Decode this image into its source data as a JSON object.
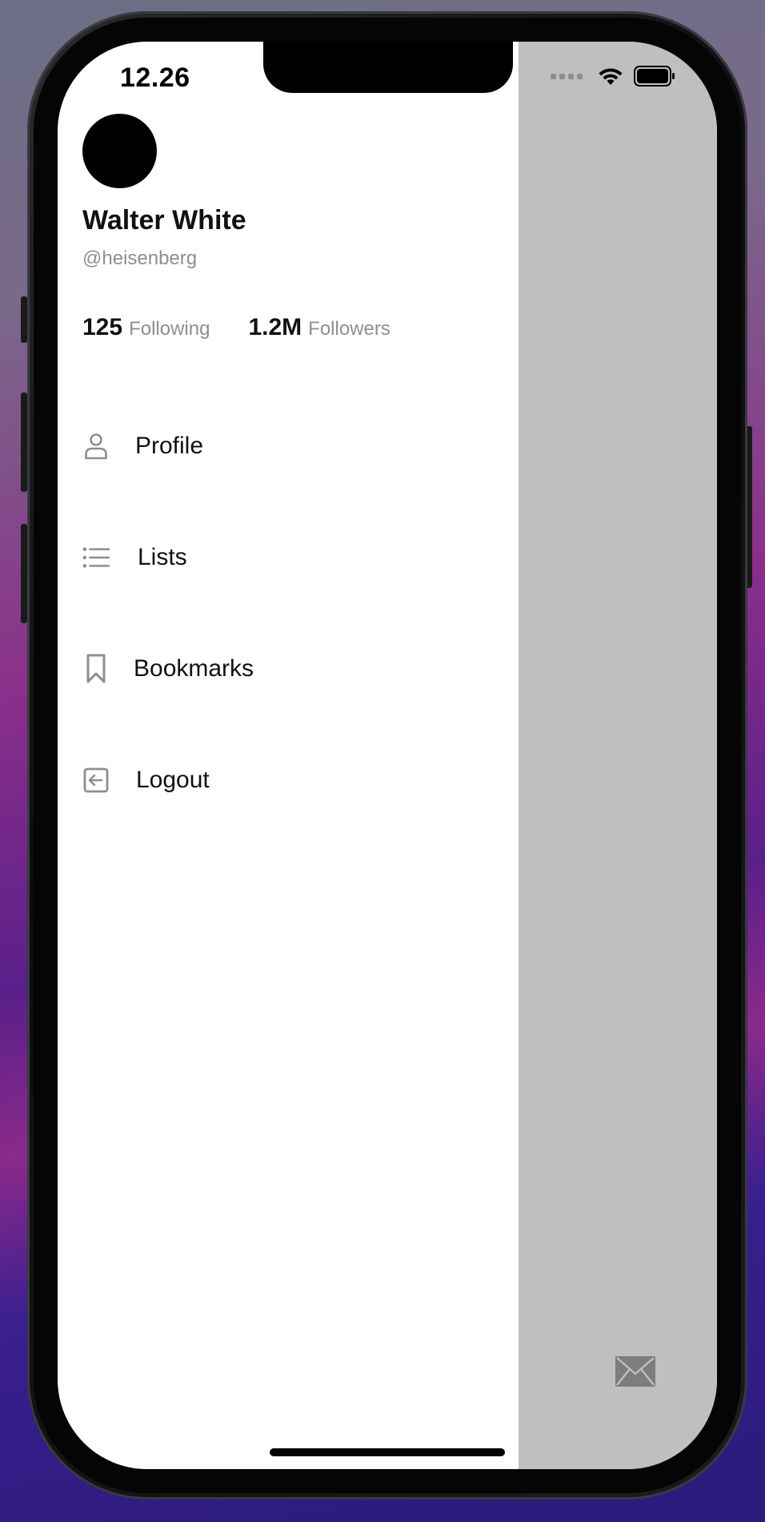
{
  "status_bar": {
    "time": "12.26",
    "icons": [
      "cellular-signal-icon",
      "wifi-icon",
      "battery-icon"
    ]
  },
  "profile": {
    "name": "Walter White",
    "handle": "@heisenberg",
    "following_count": "125",
    "following_label": "Following",
    "followers_count": "1.2M",
    "followers_label": "Followers"
  },
  "menu": {
    "items": [
      {
        "label": "Profile",
        "icon": "person-icon"
      },
      {
        "label": "Lists",
        "icon": "list-icon"
      },
      {
        "label": "Bookmarks",
        "icon": "bookmark-icon"
      },
      {
        "label": "Logout",
        "icon": "logout-icon"
      }
    ]
  },
  "fab": {
    "icon": "mail-icon"
  },
  "colors": {
    "overlay": "#bfbfbf",
    "icon_gray": "#8e8e93",
    "text_primary": "#111111",
    "text_secondary": "#8e8e93"
  }
}
